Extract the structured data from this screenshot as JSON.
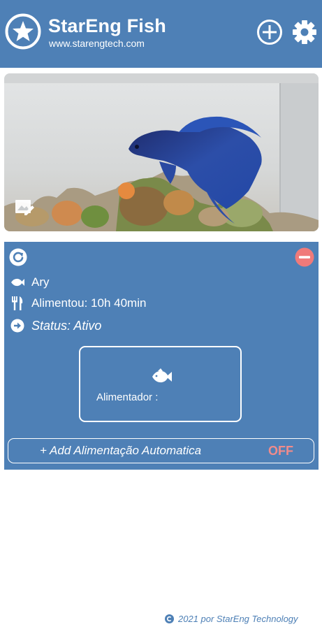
{
  "header": {
    "title": "StarEng Fish",
    "url": "www.starengtech.com",
    "logo_icon": "star-icon",
    "add_icon": "add-circle-icon",
    "settings_icon": "gear-icon"
  },
  "photo": {
    "edit_icon": "edit-image-icon"
  },
  "card": {
    "refresh_icon": "refresh-icon",
    "remove_icon": "remove-circle-icon",
    "fish_name": "Ary",
    "fed_text": "Alimentou: 10h 40min",
    "status_text": "Status: Ativo",
    "feeder_label": "Alimentador :",
    "auto_feed_label": "+ Add Alimentação Automatica",
    "auto_feed_state": "OFF"
  },
  "footer": {
    "text": "2021 por StarEng Technology"
  },
  "colors": {
    "primary": "#4e80b6",
    "off": "#f08b8b",
    "remove": "#f07a7a"
  }
}
